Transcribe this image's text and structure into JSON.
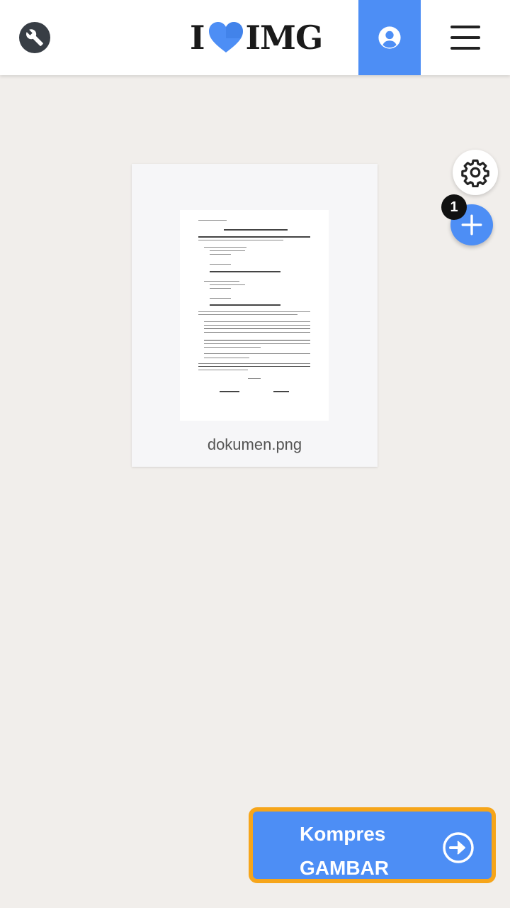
{
  "header": {
    "logo_left": "I",
    "logo_right": "IMG",
    "icons": {
      "tools": "wrench-icon",
      "user": "user-circle-icon",
      "menu": "hamburger-menu-icon"
    },
    "brand_color": "#4d8ef5"
  },
  "file": {
    "name": "dokumen.png"
  },
  "side_actions": {
    "settings_icon": "gear-icon",
    "add_icon": "plus-icon",
    "file_count": "1"
  },
  "action": {
    "line1": "Kompres",
    "line2": "GAMBAR",
    "icon": "arrow-right-circle-icon",
    "highlight_color": "#f6a51a"
  }
}
